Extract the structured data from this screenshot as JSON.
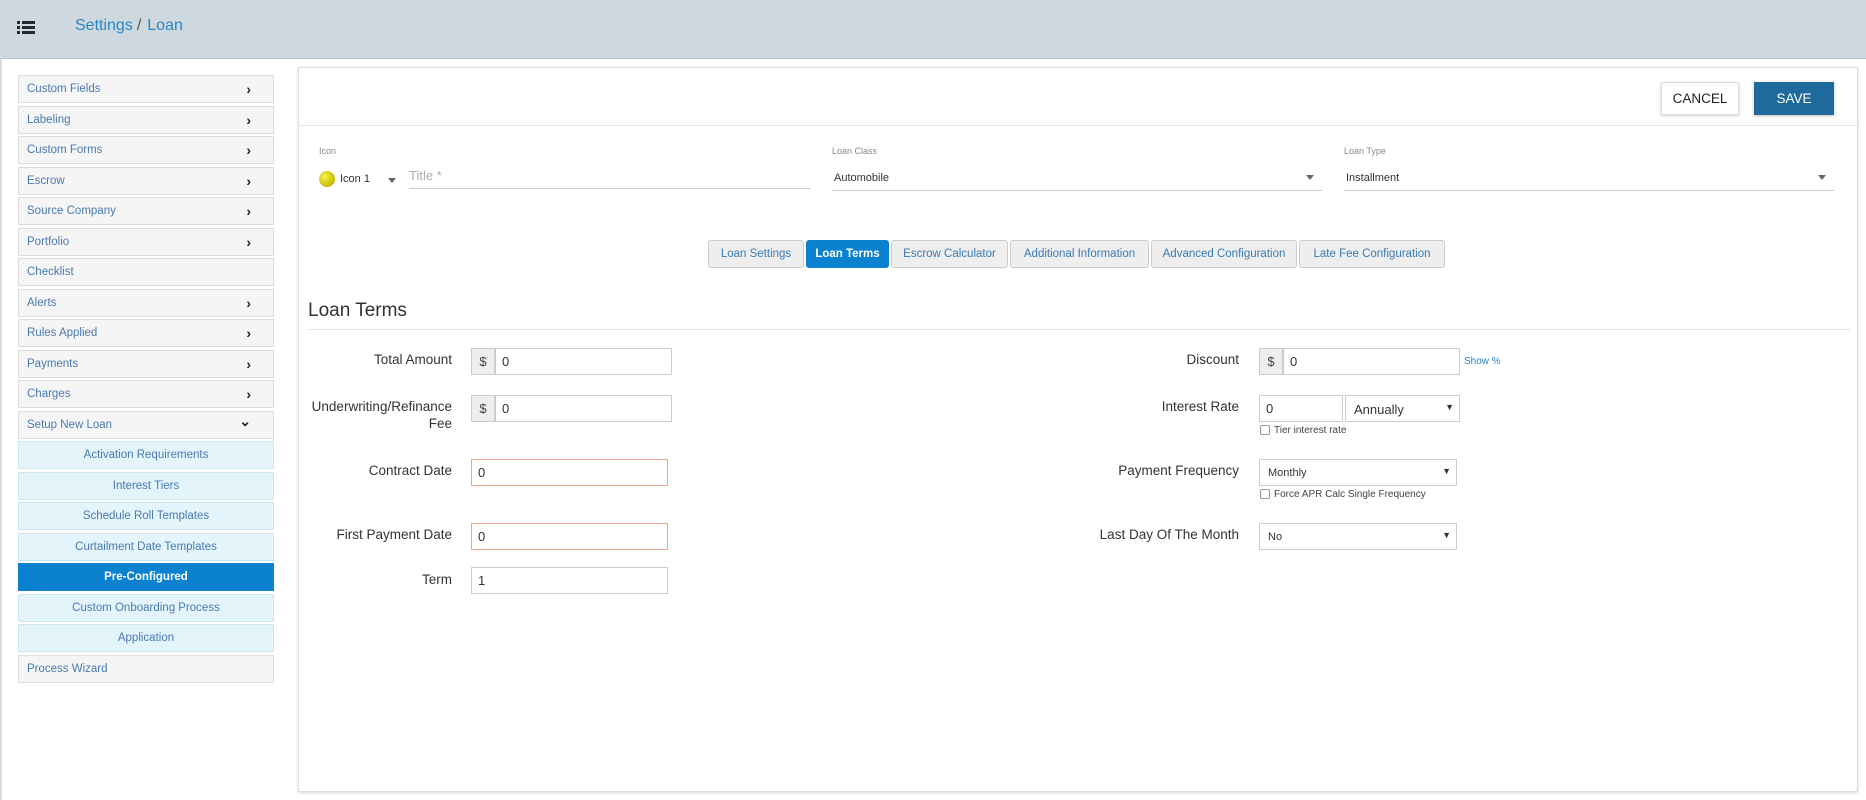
{
  "breadcrumb": {
    "root": "Settings",
    "separator": "/",
    "current": "Loan"
  },
  "sidebar": {
    "items": [
      {
        "label": "Custom Fields",
        "chevron": "›"
      },
      {
        "label": "Labeling",
        "chevron": "›"
      },
      {
        "label": "Custom Forms",
        "chevron": "›"
      },
      {
        "label": "Escrow",
        "chevron": "›"
      },
      {
        "label": "Source Company",
        "chevron": "›"
      },
      {
        "label": "Portfolio",
        "chevron": "›"
      },
      {
        "label": "Checklist",
        "chevron": ""
      },
      {
        "label": "Alerts",
        "chevron": "›"
      },
      {
        "label": "Rules Applied",
        "chevron": "›"
      },
      {
        "label": "Payments",
        "chevron": "›"
      },
      {
        "label": "Charges",
        "chevron": "›"
      },
      {
        "label": "Setup New Loan",
        "chevron": "⌄"
      }
    ],
    "subitems": [
      {
        "label": "Activation Requirements"
      },
      {
        "label": "Interest Tiers"
      },
      {
        "label": "Schedule Roll Templates"
      },
      {
        "label": "Curtailment Date Templates"
      },
      {
        "label": "Pre-Configured",
        "active": true
      },
      {
        "label": "Custom Onboarding Process"
      },
      {
        "label": "Application"
      }
    ],
    "last_item": {
      "label": "Process Wizard"
    }
  },
  "header": {
    "cancel_label": "CANCEL",
    "save_label": "SAVE"
  },
  "form_top": {
    "icon_label": "Icon",
    "icon_value": "Icon 1",
    "title_placeholder": "Title *",
    "loan_class_label": "Loan Class",
    "loan_class_value": "Automobile",
    "loan_type_label": "Loan Type",
    "loan_type_value": "Installment"
  },
  "tabs": [
    {
      "label": "Loan Settings"
    },
    {
      "label": "Loan Terms",
      "active": true
    },
    {
      "label": "Escrow Calculator"
    },
    {
      "label": "Additional Information"
    },
    {
      "label": "Advanced Configuration"
    },
    {
      "label": "Late Fee Configuration"
    }
  ],
  "loan_terms": {
    "section_title": "Loan Terms",
    "total_amount": {
      "label": "Total Amount",
      "prefix": "$",
      "value": "0"
    },
    "underwriting_fee": {
      "label_line1": "Underwriting/Refinance",
      "label_line2": "Fee",
      "prefix": "$",
      "value": "0"
    },
    "contract_date": {
      "label": "Contract Date",
      "value": "0"
    },
    "first_payment_date": {
      "label": "First Payment Date",
      "value": "0"
    },
    "term": {
      "label": "Term",
      "value": "1"
    },
    "discount": {
      "label": "Discount",
      "prefix": "$",
      "value": "0",
      "toggle_link": "Show %"
    },
    "interest_rate": {
      "label": "Interest Rate",
      "value": "0",
      "period": "Annually",
      "tier_label": "Tier interest rate"
    },
    "payment_frequency": {
      "label": "Payment Frequency",
      "value": "Monthly",
      "force_apr_label": "Force APR Calc Single Frequency"
    },
    "last_day_of_month": {
      "label": "Last Day Of The Month",
      "value": "No"
    }
  },
  "colors": {
    "topbar": "#cdd9df",
    "accent": "#0a82d0",
    "save": "#1e6a9a",
    "error_border": "#f0a58a"
  }
}
